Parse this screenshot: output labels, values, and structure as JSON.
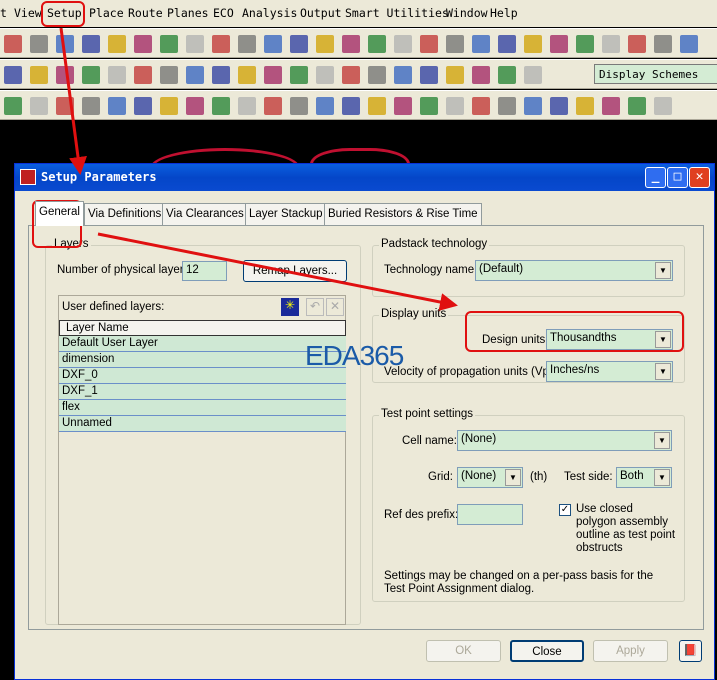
{
  "menu": [
    "t",
    "View",
    "Setup",
    "Place",
    "Route",
    "Planes",
    "ECO",
    "Analysis",
    "Output",
    "Smart Utilities",
    "Window",
    "Help"
  ],
  "toolbar": {
    "display_schemes": "Display Schemes"
  },
  "dialog": {
    "title": "Setup Parameters",
    "tabs": [
      "General",
      "Via Definitions",
      "Via Clearances",
      "Layer Stackup",
      "Buried Resistors & Rise Time"
    ],
    "layers": {
      "group": "Layers",
      "num_label": "Number of physical layers:",
      "num_value": "12",
      "remap": "Remap Layers...",
      "user_defined": "User defined layers:",
      "column": "Layer Name",
      "rows": [
        "Default User Layer",
        "dimension",
        "DXF_0",
        "DXF_1",
        "flex",
        "Unnamed"
      ]
    },
    "padstack": {
      "group": "Padstack technology",
      "tech_label": "Technology name:",
      "tech_value": "(Default)"
    },
    "display": {
      "group": "Display units",
      "design_label": "Design units:",
      "design_value": "Thousandths",
      "velocity_label": "Velocity of propagation units (Vp):",
      "velocity_value": "Inches/ns"
    },
    "testpoint": {
      "group": "Test point settings",
      "cell_label": "Cell name:",
      "cell_value": "(None)",
      "grid_label": "Grid:",
      "grid_value": "(None)",
      "grid_unit": "(th)",
      "side_label": "Test side:",
      "side_value": "Both",
      "refdes_label": "Ref des prefix:",
      "refdes_value": "",
      "closed_poly": "Use closed polygon assembly outline as test point obstructs",
      "closed_poly_checked": true,
      "note": "Settings may be changed on a per-pass basis for the Test Point Assignment dialog."
    },
    "buttons": {
      "ok": "OK",
      "close": "Close",
      "apply": "Apply"
    }
  },
  "watermark": "EDA365",
  "colors": {
    "annotation": "#e01010",
    "field": "#d4ecd4",
    "title": "#0a5fe0"
  }
}
